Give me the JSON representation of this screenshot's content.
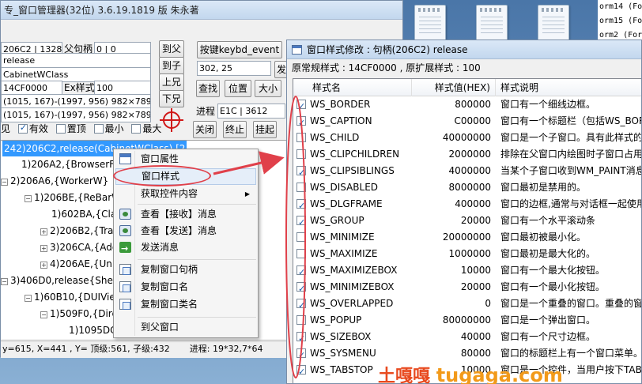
{
  "main_window": {
    "title": "窗口管理器(32位) 3.6.19.1819 版 朱永著",
    "title_prefix": "专_",
    "handle": "206C2 | 1328",
    "parent_label": "父句柄",
    "parent_value": "0 | 0",
    "text_value": "release",
    "class_value": "CabinetWClass",
    "style_value": "14CF0000",
    "exstyle_label": "Ex样式",
    "exstyle_value": "100",
    "rect1": "(1015, 167)-(1997, 956) 982×789",
    "rect2": "(1015, 167)-(1997, 956) 982×789",
    "nav_buttons": [
      "到父",
      "到子",
      "上兄",
      "下兄"
    ],
    "keybd_button": "按键keybd_event",
    "coords_input": "302, 25",
    "ok_button_partial": "发",
    "action_buttons": [
      "查找",
      "位置",
      "大小"
    ],
    "process_label": "进程",
    "process_value": "E1C | 3612",
    "bottom_buttons": [
      "关闭",
      "终止",
      "挂起"
    ],
    "checks": [
      {
        "label": "见",
        "checked": true
      },
      {
        "label": "有效",
        "checked": true
      },
      {
        "label": "置顶",
        "checked": false
      },
      {
        "label": "最小",
        "checked": false
      },
      {
        "label": "最大",
        "checked": false
      }
    ]
  },
  "tree": {
    "nodes": [
      {
        "text": "242)206C2,release(CabinetWClass) [2",
        "expander": "",
        "selected": true
      },
      {
        "text": "1)206A2,{BrowserFra",
        "expander": "",
        "selected": false
      },
      {
        "text": "2)206A6,{WorkerW}",
        "expander": "−",
        "selected": false
      },
      {
        "text": "1)206BE,{ReBarW",
        "expander": "−",
        "selected": false
      },
      {
        "text": "1)602BA,{Clas",
        "expander": "",
        "selected": false
      },
      {
        "text": "2)206B2,{Trav",
        "expander": "+",
        "selected": false
      },
      {
        "text": "3)206CA,{Add",
        "expander": "+",
        "selected": false
      },
      {
        "text": "4)206AE,{Univ",
        "expander": "+",
        "selected": false
      },
      {
        "text": "3)406D0,release{She",
        "expander": "−",
        "selected": false
      },
      {
        "text": "1)60B10,{DUIVie",
        "expander": "−",
        "selected": false
      },
      {
        "text": "1)509F0,{Direc",
        "expander": "−",
        "selected": false
      },
      {
        "text": "1)1095DC",
        "expander": "",
        "selected": false
      }
    ]
  },
  "statusbar": {
    "left": "y=615, X=441 , Y= 顶级:561, 子级:432",
    "right": "进程: 19*32,7*64"
  },
  "context_menu": {
    "items": [
      {
        "label": "窗口属性",
        "icon": "window-icon",
        "highlight": false,
        "submenu": false
      },
      {
        "label": "窗口样式",
        "icon": "",
        "highlight": true,
        "submenu": false
      },
      {
        "label": "获取控件内容",
        "icon": "",
        "highlight": false,
        "submenu": true
      },
      {
        "label": "查看【接收】消息",
        "icon": "view-icon",
        "highlight": false,
        "submenu": false
      },
      {
        "label": "查看【发送】消息",
        "icon": "view-icon",
        "highlight": false,
        "submenu": false
      },
      {
        "label": "发送消息",
        "icon": "send-icon",
        "highlight": false,
        "submenu": false
      },
      {
        "label": "复制窗口句柄",
        "icon": "copy-icon",
        "highlight": false,
        "submenu": false
      },
      {
        "label": "复制窗口名",
        "icon": "copy-icon",
        "highlight": false,
        "submenu": false
      },
      {
        "label": "复制窗口类名",
        "icon": "copy-icon",
        "highlight": false,
        "submenu": false
      },
      {
        "label": "到父窗口",
        "icon": "",
        "highlight": false,
        "submenu": false
      }
    ]
  },
  "style_window": {
    "title": "窗口样式修改 : 句柄(206C2) release",
    "info": "原常规样式 : 14CF0000 , 原扩展样式 : 100",
    "columns": [
      "样式名",
      "样式值(HEX)",
      "样式说明"
    ],
    "rows": [
      {
        "name": "WS_BORDER",
        "value": "800000",
        "desc": "窗口有一个细线边框。",
        "checked": true
      },
      {
        "name": "WS_CAPTION",
        "value": "C00000",
        "desc": "窗口有一个标题栏（包括WS_BOR",
        "checked": true
      },
      {
        "name": "WS_CHILD",
        "value": "40000000",
        "desc": "窗口是一个子窗口。具有此样式的",
        "checked": false
      },
      {
        "name": "WS_CLIPCHILDREN",
        "value": "2000000",
        "desc": "排除在父窗口内绘图时子窗口占用",
        "checked": false
      },
      {
        "name": "WS_CLIPSIBLINGS",
        "value": "4000000",
        "desc": "当某个子窗口收到WM_PAINT消息",
        "checked": true
      },
      {
        "name": "WS_DISABLED",
        "value": "8000000",
        "desc": "窗口最初是禁用的。",
        "checked": false
      },
      {
        "name": "WS_DLGFRAME",
        "value": "400000",
        "desc": "窗口的边框,通常与对话框一起使用",
        "checked": true
      },
      {
        "name": "WS_GROUP",
        "value": "20000",
        "desc": "窗口有一个水平滚动条",
        "checked": true
      },
      {
        "name": "WS_MINIMIZE",
        "value": "20000000",
        "desc": "窗口最初被最小化。",
        "checked": false
      },
      {
        "name": "WS_MAXIMIZE",
        "value": "1000000",
        "desc": "窗口最初是最大化的。",
        "checked": false
      },
      {
        "name": "WS_MAXIMIZEBOX",
        "value": "10000",
        "desc": "窗口有一个最大化按钮。",
        "checked": true
      },
      {
        "name": "WS_MINIMIZEBOX",
        "value": "20000",
        "desc": "窗口有一个最小化按钮。",
        "checked": true
      },
      {
        "name": "WS_OVERLAPPED",
        "value": "0",
        "desc": "窗口是一个重叠的窗口。重叠的窗口",
        "checked": true
      },
      {
        "name": "WS_POPUP",
        "value": "80000000",
        "desc": "窗口是一个弹出窗口。",
        "checked": false
      },
      {
        "name": "WS_SIZEBOX",
        "value": "40000",
        "desc": "窗口有一个尺寸边框。",
        "checked": true
      },
      {
        "name": "WS_SYSMENU",
        "value": "80000",
        "desc": "窗口的标题栏上有一个窗口菜单。",
        "checked": true
      },
      {
        "name": "WS_TABSTOP",
        "value": "10000",
        "desc": "窗口是一个控件，当用户按下TAB",
        "checked": true
      }
    ]
  },
  "background_text": [
    "orm14 (Fo",
    "orm15 (Fo",
    "orm2 (Form"
  ],
  "watermark": {
    "cn": "土嘎嘎",
    "url": "tugaga.com"
  }
}
